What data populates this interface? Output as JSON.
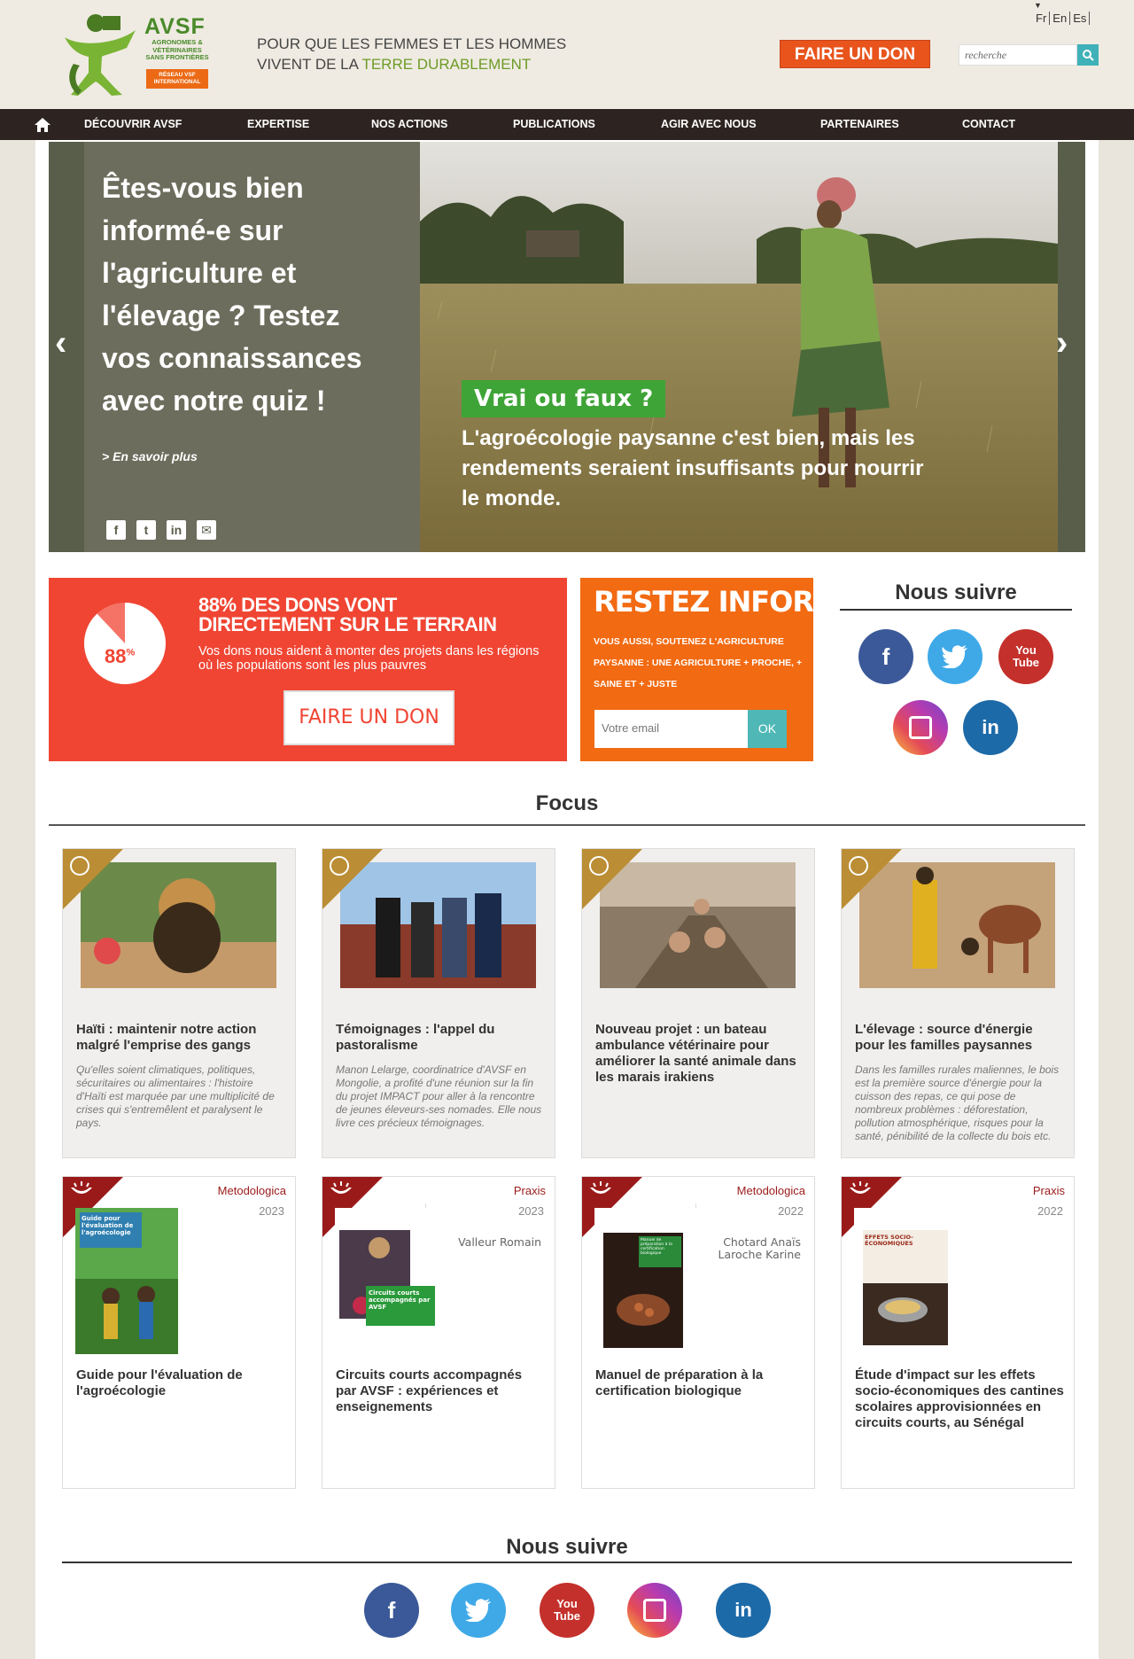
{
  "header": {
    "logo_word": "AVSF",
    "logo_sub": "AGRONOMES & VÉTÉRINAIRES SANS FRONTIÈRES",
    "logo_badge": "RÉSEAU VSF INTERNATIONAL",
    "tagline_line1": "POUR QUE LES FEMMES ET LES HOMMES",
    "tagline_line2_a": "VIVENT DE LA ",
    "tagline_line2_b": "TERRE",
    "tagline_line2_c": " DURABLEMENT",
    "languages": [
      "Fr",
      "En",
      "Es"
    ],
    "donate_label": "FAIRE UN DON",
    "search_placeholder": "recherche"
  },
  "nav": {
    "items": [
      "DÉCOUVRIR AVSF",
      "EXPERTISE",
      "NOS ACTIONS",
      "PUBLICATIONS",
      "AGIR AVEC NOUS",
      "PARTENAIRES",
      "CONTACT"
    ]
  },
  "slider": {
    "title": "Êtes-vous bien informé-e sur l'agriculture et l'élevage ? Testez vos connaissances avec notre quiz !",
    "more": "> En savoir plus",
    "badge": "Vrai ou faux ?",
    "caption": "L'agroécologie paysanne c'est bien, mais les rendements seraient insuffisants pour nourrir le monde.",
    "share_icons": [
      "facebook-icon",
      "twitter-icon",
      "linkedin-icon",
      "mail-icon"
    ]
  },
  "dons": {
    "percent": "88",
    "percent_sign": "%",
    "percent_fraction": 0.88,
    "title_line1": "88% DES DONS VONT",
    "title_line2": "DIRECTEMENT SUR LE TERRAIN",
    "text": "Vos dons nous aident à monter des projets dans les régions où les populations sont les plus pauvres",
    "button": "FAIRE UN DON"
  },
  "newsletter": {
    "title": "RESTEZ INFORMÉ !",
    "text": "Vous aussi, soutenez l'agriculture paysanne : une agriculture + proche, + saine et + juste",
    "placeholder": "Votre email",
    "ok": "OK"
  },
  "follow": {
    "title": "Nous suivre"
  },
  "focus": {
    "title": "Focus",
    "cards": [
      {
        "title": "Haïti : maintenir notre action malgré l'emprise des gangs",
        "text": "Qu'elles soient climatiques, politiques, sécuritaires ou alimentaires : l'histoire d'Haïti est marquée par une multiplicité de crises qui s'entremêlent et paralysent le pays."
      },
      {
        "title": "Témoignages : l'appel du pastoralisme",
        "text": "Manon Lelarge, coordinatrice d'AVSF en Mongolie, a profité d'une réunion sur la fin du projet IMPACT pour aller à la rencontre de jeunes éleveurs-ses nomades. Elle nous livre ces précieux témoignages."
      },
      {
        "title": "Nouveau projet : un bateau ambulance vétérinaire pour améliorer la santé animale dans les marais irakiens",
        "text": ""
      },
      {
        "title": "L'élevage : source d'énergie pour les familles paysannes",
        "text": "Dans les familles rurales maliennes, le bois est la première source d'énergie pour la cuisson des repas, ce qui pose de nombreux problèmes : déforestation, pollution atmosphérique, risques pour la santé, pénibilité de la collecte du bois etc."
      }
    ],
    "publications": [
      {
        "type": "Metodologica",
        "year": "2023",
        "author": "",
        "title": "Guide pour l'évaluation de l'agroécologie",
        "cover_text": "Guide pour l'évaluation de l'agroécologie"
      },
      {
        "type": "Praxis",
        "year": "2023",
        "author": "Valleur Romain",
        "title": "Circuits courts accompagnés par AVSF : expériences et enseignements",
        "cover_text": "Circuits courts accompagnés par AVSF"
      },
      {
        "type": "Metodologica",
        "year": "2022",
        "author": "Chotard Anaïs\nLaroche Karine",
        "title": "Manuel de préparation à la certification biologique",
        "cover_text": "Manuel de préparation à la certification biologique"
      },
      {
        "type": "Praxis",
        "year": "2022",
        "author": "",
        "title": "Étude d'impact sur les effets socio-économiques des cantines scolaires approvisionnées en circuits courts, au Sénégal",
        "cover_text": "EFFETS SOCIO-ÉCONOMIQUES"
      }
    ]
  },
  "footer": {
    "follow_title": "Nous suivre"
  },
  "colors": {
    "nav_bg": "#2d2421",
    "donate_orange": "#e8541c",
    "dons_red": "#f04533",
    "news_orange": "#f26a12",
    "focus_gold": "#bb8d35",
    "pub_red": "#9a1a1a",
    "green": "#6e9b27"
  }
}
